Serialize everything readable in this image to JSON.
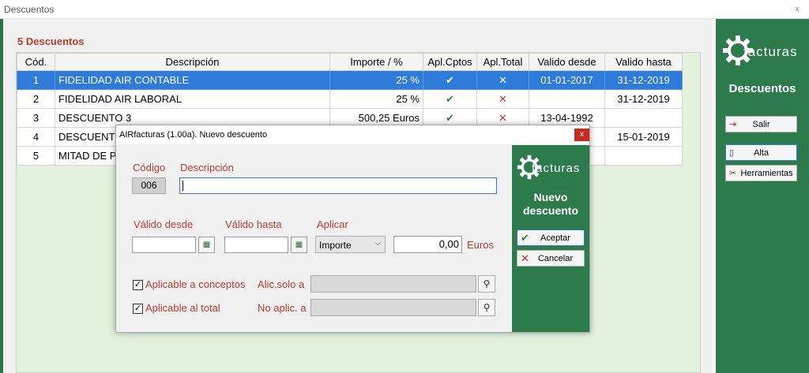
{
  "window": {
    "title": "Descuentos",
    "close_glyph": "x"
  },
  "list": {
    "count_label": "5 Descuentos",
    "columns": [
      "Cód.",
      "Descripción",
      "Importe / %",
      "Apl.Cptos",
      "Apl.Total",
      "Valido desde",
      "Valido hasta"
    ],
    "rows": [
      {
        "cod": "1",
        "desc": "FIDELIDAD AIR CONTABLE",
        "importe": "25 %",
        "cptos": "✔",
        "total": "✕",
        "desde": "01-01-2017",
        "hasta": "31-12-2019"
      },
      {
        "cod": "2",
        "desc": "FIDELIDAD AIR LABORAL",
        "importe": "25 %",
        "cptos": "✔",
        "total": "✕",
        "desde": "",
        "hasta": "31-12-2019"
      },
      {
        "cod": "3",
        "desc": "DESCUENTO 3",
        "importe": "500,25 Euros",
        "cptos": "✔",
        "total": "✕",
        "desde": "13-04-1992",
        "hasta": ""
      },
      {
        "cod": "4",
        "desc": "DESCUENT",
        "importe": "",
        "cptos": "",
        "total": "",
        "desde": "",
        "hasta": "15-01-2019"
      },
      {
        "cod": "5",
        "desc": "MITAD DE P",
        "importe": "",
        "cptos": "",
        "total": "",
        "desde": "",
        "hasta": ""
      }
    ]
  },
  "sidebar": {
    "logo_text": "facturas",
    "title": "Descuentos",
    "buttons": {
      "salir": "Salir",
      "alta": "Alta",
      "herramientas": "Herramientas"
    }
  },
  "dialog": {
    "title": "AIRfacturas (1.00a). Nuevo descuento",
    "close_glyph": "x",
    "labels": {
      "codigo": "Código",
      "descripcion": "Descripción",
      "valido_desde": "Válido desde",
      "valido_hasta": "Válido hasta",
      "aplicar": "Aplicar",
      "euros": "Euros",
      "alic_solo": "Alic.solo a",
      "no_aplic": "No aplic. a"
    },
    "codigo_value": "006",
    "descripcion_value": "",
    "aplicar_selected": "Importe",
    "amount_value": "0,00",
    "checkboxes": {
      "conceptos": {
        "label": "Aplicable a conceptos",
        "checked": true
      },
      "total": {
        "label": "Aplicable al total",
        "checked": true
      }
    },
    "panel": {
      "logo_text": "facturas",
      "title_line1": "Nuevo",
      "title_line2": "descuento",
      "aceptar": "Aceptar",
      "cancelar": "Cancelar"
    }
  },
  "colors": {
    "accent_green": "#2d7a4c",
    "label_red": "#c0392b",
    "selection_blue": "#2f7bd9"
  }
}
